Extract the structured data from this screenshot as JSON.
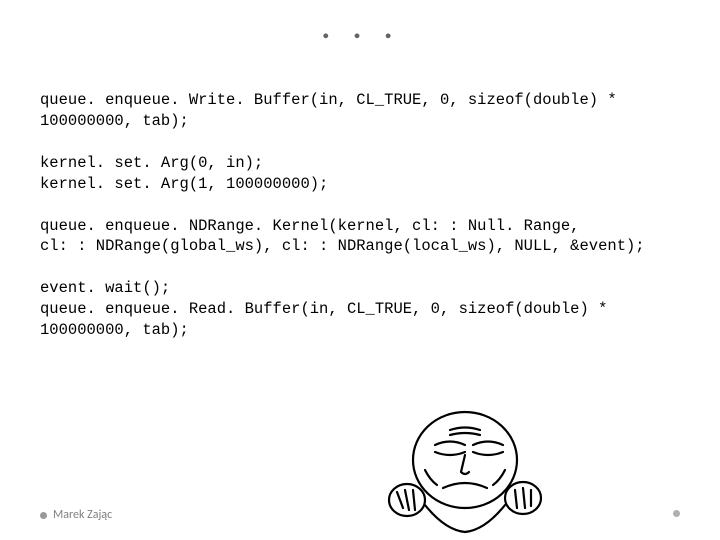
{
  "title": ". . .",
  "code": {
    "l1": "queue. enqueue. Write. Buffer(in, CL_TRUE, 0, sizeof(double) *",
    "l2": "100000000, tab);",
    "l3": "",
    "l4": "kernel. set. Arg(0, in);",
    "l5": "kernel. set. Arg(1, 100000000);",
    "l6": "",
    "l7": "queue. enqueue. NDRange. Kernel(kernel, cl: : Null. Range,",
    "l8": "cl: : NDRange(global_ws), cl: : NDRange(local_ws), NULL, &event);",
    "l9": "",
    "l10": "event. wait();",
    "l11": "queue. enqueue. Read. Buffer(in, CL_TRUE, 0, sizeof(double) *",
    "l12": "100000000, tab);"
  },
  "footer": {
    "author": "Marek Zając"
  },
  "illustration": {
    "name": "cartoon-face-squinting"
  }
}
